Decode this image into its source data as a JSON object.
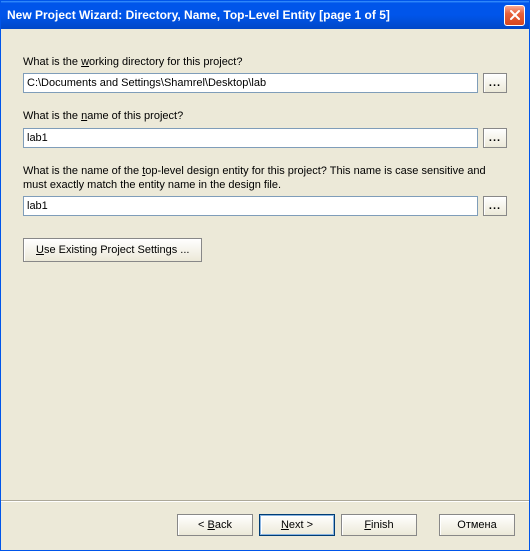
{
  "window": {
    "title": "New Project Wizard: Directory, Name, Top-Level Entity [page 1 of 5]"
  },
  "labels": {
    "working_dir_pre": "What is the ",
    "working_dir_u": "w",
    "working_dir_post": "orking directory for this project?",
    "project_name_pre": "What is the ",
    "project_name_u": "n",
    "project_name_post": "ame of this project?",
    "top_level_pre": "What is the name of the ",
    "top_level_u": "t",
    "top_level_post": "op-level design entity for this project? This name is case sensitive and must exactly match the entity name in the design file."
  },
  "fields": {
    "working_dir": "C:\\Documents and Settings\\Shamrel\\Desktop\\lab",
    "project_name": "lab1",
    "top_level": "lab1"
  },
  "buttons": {
    "browse": "...",
    "use_existing_u": "U",
    "use_existing_post": "se Existing Project Settings ...",
    "back_pre": "< ",
    "back_u": "B",
    "back_post": "ack",
    "next_u": "N",
    "next_post": "ext >",
    "finish_u": "F",
    "finish_post": "inish",
    "cancel": "Отмена"
  }
}
